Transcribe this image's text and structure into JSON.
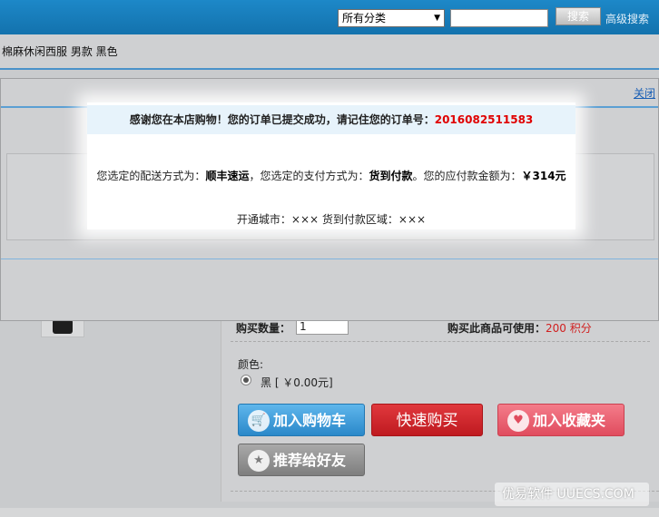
{
  "topbar": {
    "category_select": "所有分类",
    "search_placeholder": "",
    "search_button": "搜索",
    "advanced_search": "高级搜索"
  },
  "product": {
    "title": "棉麻休闲西服  男款  黑色",
    "quantity_label": "购买数量：",
    "quantity_value": "1",
    "points_label": "购买此商品可使用：",
    "points_value": "200  积分",
    "color_label": "颜色:",
    "color_option": "黑 [ ￥0.00元]"
  },
  "buttons": {
    "add_to_cart": "加入购物车",
    "buy_now": "快速购买",
    "add_favorite": "加入收藏夹",
    "recommend": "推荐给好友"
  },
  "modal": {
    "close": "关闭",
    "thanks_text": "感谢您在本店购物！您的订单已提交成功，请记住您的订单号：",
    "order_number": "2016082511583",
    "shipping_prefix": "您选定的配送方式为：",
    "shipping_method": "顺丰速运",
    "payment_prefix": "，您选定的支付方式为：",
    "payment_method": "货到付款",
    "amount_prefix": "。您的应付款金额为：",
    "amount": "￥314元",
    "area_text": "开通城市：××× 货到付款区域：×××"
  },
  "watermark": "优易软件 UUECS.COM",
  "icons": {
    "cart": "cart-icon",
    "favorite": "heart-icon",
    "recommend": "star-icon",
    "dropdown": "chevron-down-icon"
  },
  "colors": {
    "topbar": "#1d88c8",
    "order_number": "#e00000",
    "buy_now": "#c9232a"
  }
}
